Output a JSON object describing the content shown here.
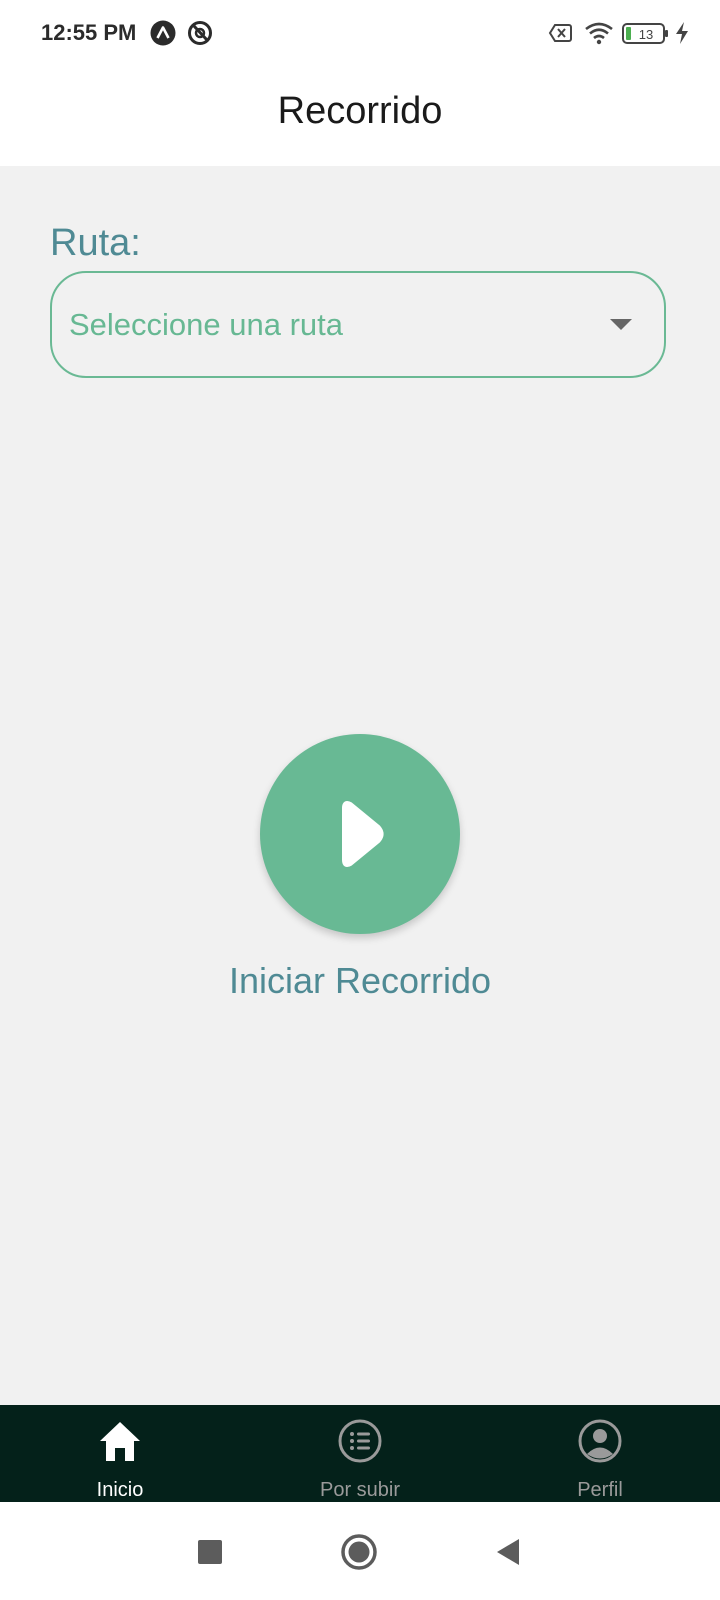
{
  "status_bar": {
    "time": "12:55 PM",
    "left_icons": [
      "app-a-icon",
      "no-sync-icon"
    ],
    "right_icons": [
      "sim-off-icon",
      "wifi-icon",
      "battery-icon",
      "charging-icon"
    ],
    "battery_level": "13"
  },
  "app_bar": {
    "title": "Recorrido"
  },
  "form": {
    "ruta_label": "Ruta:",
    "ruta_select": {
      "placeholder": "Seleccione una ruta",
      "icon": "dropdown-caret-icon"
    }
  },
  "action": {
    "icon": "play-icon",
    "label": "Iniciar Recorrido"
  },
  "bottom_nav": {
    "items": [
      {
        "label": "Inicio",
        "icon": "home-icon",
        "active": true
      },
      {
        "label": "Por subir",
        "icon": "list-icon",
        "active": false
      },
      {
        "label": "Perfil",
        "icon": "profile-icon",
        "active": false
      }
    ]
  },
  "system_nav": {
    "buttons": [
      "recents-icon",
      "home-button-icon",
      "back-icon"
    ]
  },
  "colors": {
    "accent_green": "#68b994",
    "label_teal": "#4f8a94",
    "nav_background": "#04211a",
    "nav_active": "#ffffff",
    "nav_inactive": "#9a9a9a",
    "battery_fill": "#4caf50"
  }
}
